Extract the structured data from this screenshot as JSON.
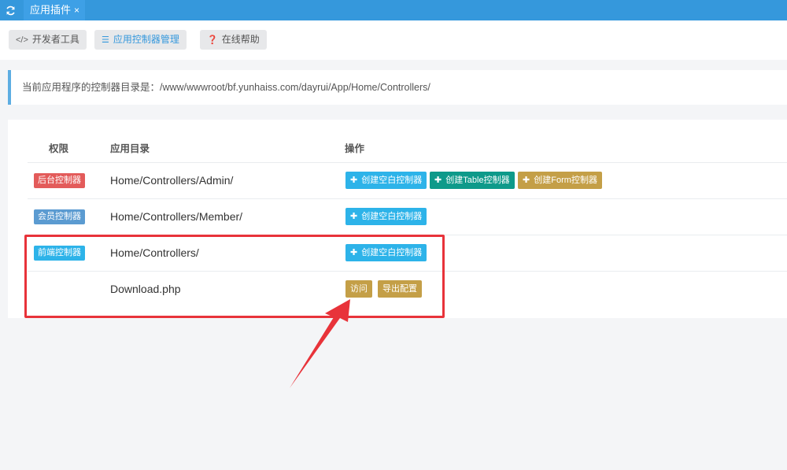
{
  "tabbar": {
    "refresh_icon": "refresh-icon",
    "tab_label": "应用插件",
    "close_glyph": "×"
  },
  "toolbar": {
    "dev_tools": {
      "icon": "code-icon",
      "label": "开发者工具"
    },
    "controller_mgmt": {
      "icon": "list-icon",
      "label": "应用控制器管理"
    },
    "online_help": {
      "icon": "question-icon",
      "label": "在线帮助"
    }
  },
  "notice": {
    "text": "当前应用程序的控制器目录是：/www/wwwroot/bf.yunhaiss.com/dayrui/App/Home/Controllers/"
  },
  "table": {
    "headers": {
      "permission": "权限",
      "app_dir": "应用目录",
      "actions": "操作"
    },
    "rows": [
      {
        "badge": "后台控制器",
        "dir": "Home/Controllers/Admin/",
        "actions": [
          "创建空白控制器",
          "创建Table控制器",
          "创建Form控制器"
        ]
      },
      {
        "badge": "会员控制器",
        "dir": "Home/Controllers/Member/",
        "actions": [
          "创建空白控制器"
        ]
      },
      {
        "badge": "前端控制器",
        "dir": "Home/Controllers/",
        "actions": [
          "创建空白控制器"
        ]
      },
      {
        "badge": "",
        "dir": "Download.php",
        "actions": [
          "访问",
          "导出配置"
        ]
      }
    ]
  },
  "colors": {
    "topbar": "#3598dc",
    "badge_admin": "#e35b5a",
    "badge_member": "#5b9bd1",
    "badge_front": "#2db3e9",
    "btn_blank": "#2db3e9",
    "btn_table": "#0e9a8a",
    "btn_form": "#c49f47",
    "annotation": "#e8333a"
  }
}
